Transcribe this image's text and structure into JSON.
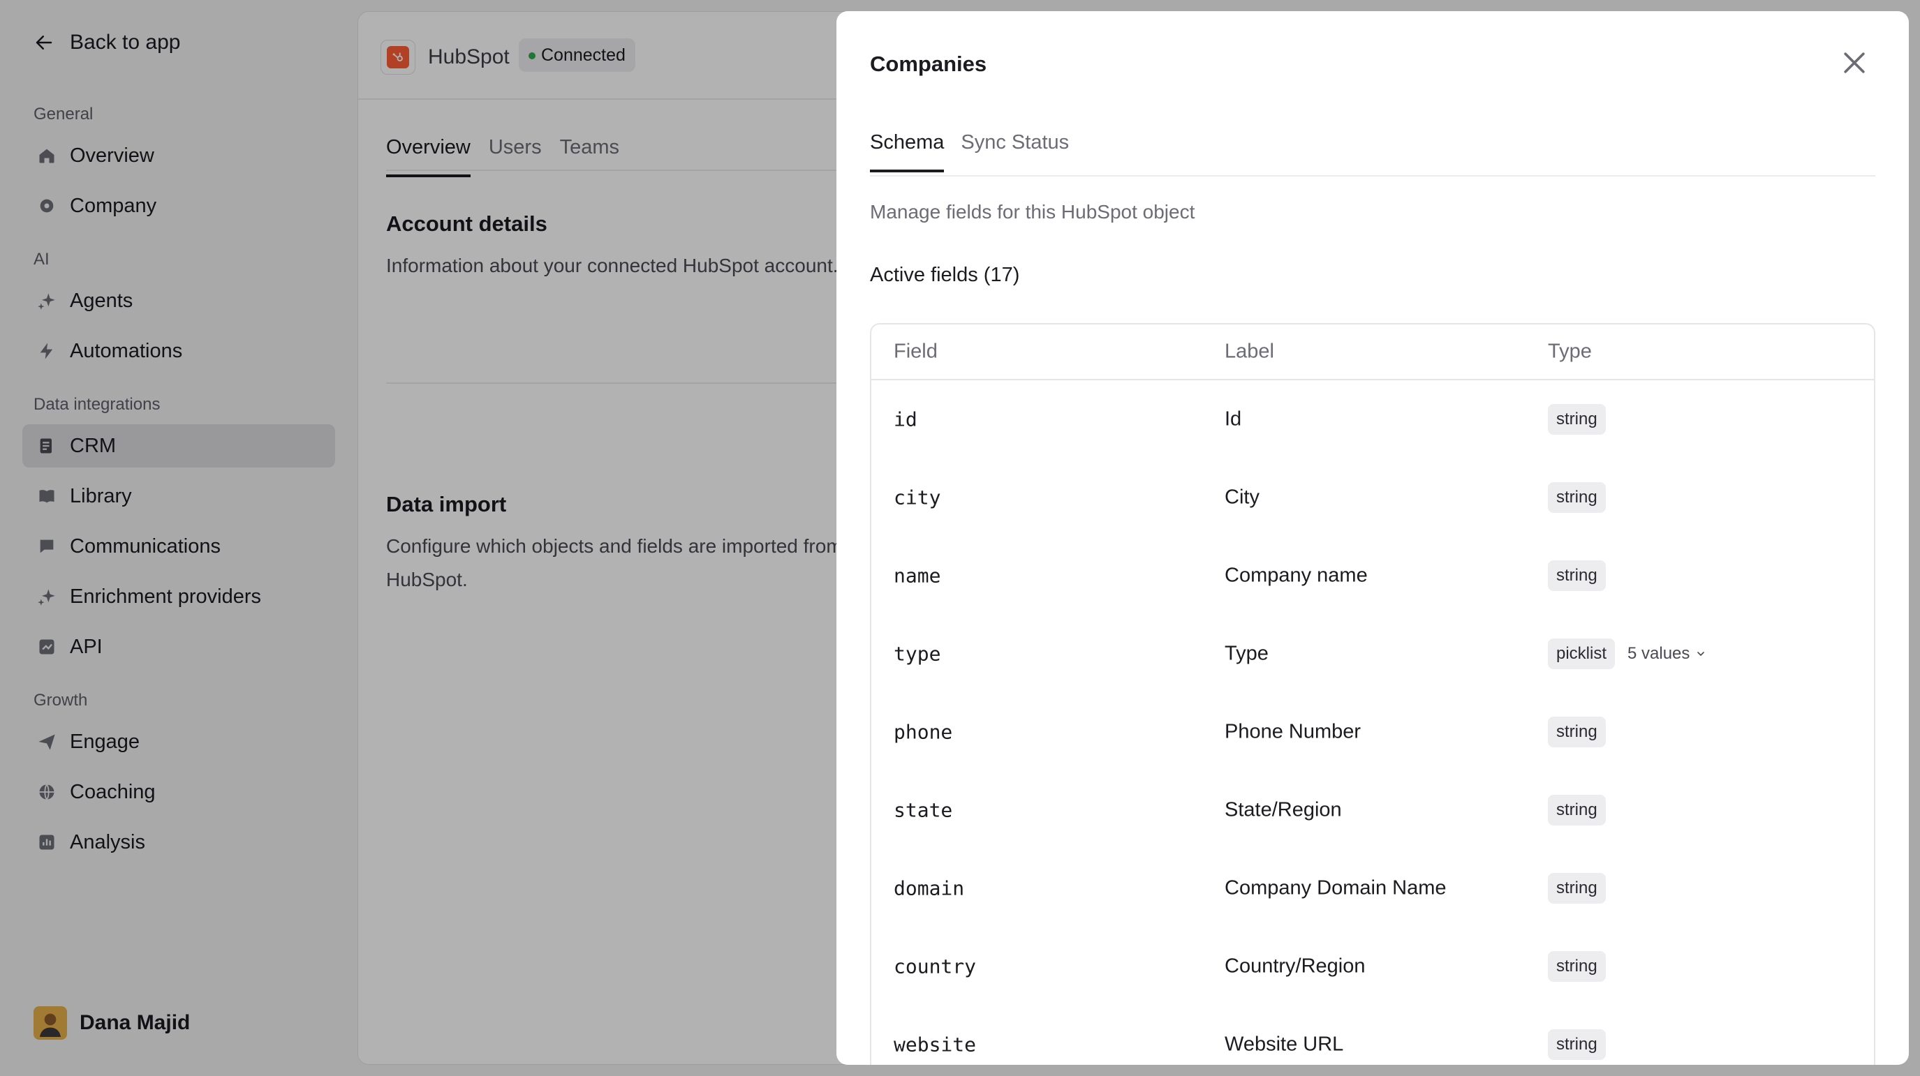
{
  "sidebar": {
    "back_label": "Back to app",
    "sections": [
      {
        "label": "General",
        "items": [
          {
            "label": "Overview",
            "icon": "home-icon"
          },
          {
            "label": "Company",
            "icon": "gear-icon"
          }
        ]
      },
      {
        "label": "AI",
        "items": [
          {
            "label": "Agents",
            "icon": "sparkles-icon"
          },
          {
            "label": "Automations",
            "icon": "lightning-icon"
          }
        ]
      },
      {
        "label": "Data integrations",
        "items": [
          {
            "label": "CRM",
            "icon": "crm-icon",
            "active": true
          },
          {
            "label": "Library",
            "icon": "book-icon"
          },
          {
            "label": "Communications",
            "icon": "chat-icon"
          },
          {
            "label": "Enrichment providers",
            "icon": "sparkles-icon"
          },
          {
            "label": "API",
            "icon": "api-icon"
          }
        ]
      },
      {
        "label": "Growth",
        "items": [
          {
            "label": "Engage",
            "icon": "send-icon"
          },
          {
            "label": "Coaching",
            "icon": "ball-icon"
          },
          {
            "label": "Analysis",
            "icon": "chart-icon"
          }
        ]
      }
    ],
    "user": {
      "name": "Dana Majid"
    }
  },
  "main": {
    "app_name": "HubSpot",
    "status": "Connected",
    "tabs": [
      "Overview",
      "Users",
      "Teams"
    ],
    "active_tab": "Overview",
    "account_title": "Account details",
    "account_desc": "Information about your connected HubSpot account.",
    "import_title": "Data import",
    "import_desc": "Configure which objects and fields are imported from HubSpot."
  },
  "panel": {
    "title": "Companies",
    "tabs": [
      "Schema",
      "Sync Status"
    ],
    "active_tab": "Schema",
    "description": "Manage fields for this HubSpot object",
    "active_fields_label": "Active fields (17)",
    "columns": [
      "Field",
      "Label",
      "Type"
    ],
    "rows": [
      {
        "field": "id",
        "label": "Id",
        "type": "string"
      },
      {
        "field": "city",
        "label": "City",
        "type": "string"
      },
      {
        "field": "name",
        "label": "Company name",
        "type": "string"
      },
      {
        "field": "type",
        "label": "Type",
        "type": "picklist",
        "values": "5 values"
      },
      {
        "field": "phone",
        "label": "Phone Number",
        "type": "string"
      },
      {
        "field": "state",
        "label": "State/Region",
        "type": "string"
      },
      {
        "field": "domain",
        "label": "Company Domain Name",
        "type": "string"
      },
      {
        "field": "country",
        "label": "Country/Region",
        "type": "string"
      },
      {
        "field": "website",
        "label": "Website URL",
        "type": "string"
      }
    ]
  },
  "colors": {
    "accent_hubspot": "#ff5c35",
    "status_green": "#2fa84f",
    "overlay": "rgba(0,0,0,0.30)"
  }
}
